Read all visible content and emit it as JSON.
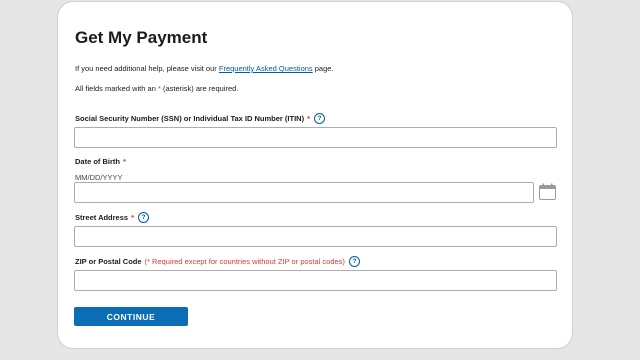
{
  "page": {
    "title": "Get My Payment",
    "help_prefix": "If you need additional help, please visit our ",
    "help_link": "Frequently Asked Questions",
    "help_suffix": " page.",
    "required_prefix": "All fields marked with an ",
    "required_star": "*",
    "required_suffix": " (asterisk) are required."
  },
  "fields": {
    "ssn": {
      "label": "Social Security Number (SSN) or Individual Tax ID Number (ITIN)",
      "required_mark": "*",
      "value": ""
    },
    "dob": {
      "label": "Date of Birth",
      "required_mark": "*",
      "hint": "MM/DD/YYYY",
      "value": ""
    },
    "street": {
      "label": "Street Address",
      "required_mark": "*",
      "value": ""
    },
    "zip": {
      "label": "ZIP or Postal Code",
      "note": "(* Required except for countries without ZIP or postal codes)",
      "value": ""
    }
  },
  "icons": {
    "help": "question-circle",
    "calendar": "calendar"
  },
  "buttons": {
    "continue": "CONTINUE"
  },
  "colors": {
    "primary": "#0b6db3",
    "link": "#005ea2",
    "required": "#d83933",
    "background": "#e6e6e6"
  }
}
